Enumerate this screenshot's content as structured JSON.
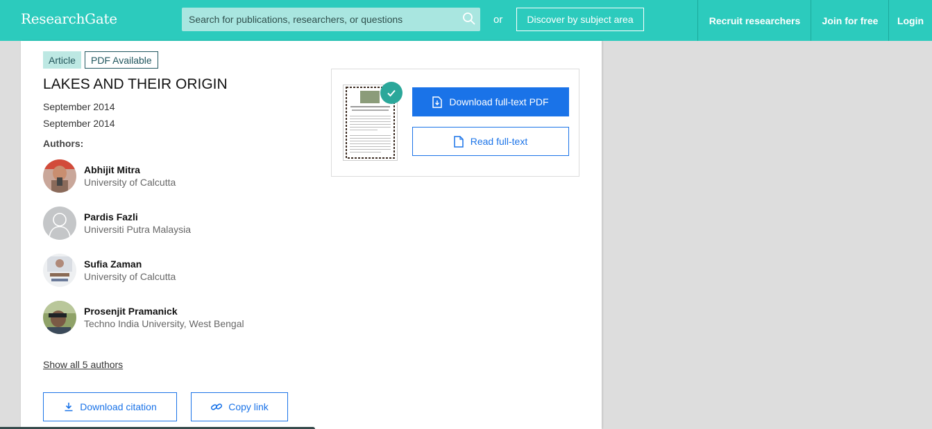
{
  "header": {
    "logo": "ResearchGate",
    "search_placeholder": "Search for publications, researchers, or questions",
    "or_text": "or",
    "discover_label": "Discover by subject area",
    "nav": [
      "Recruit researchers",
      "Join for free",
      "Login"
    ],
    "brand_color": "#2ccbbd"
  },
  "article": {
    "badge_type": "Article",
    "badge_pdf": "PDF Available",
    "title": "LAKES AND THEIR ORIGIN",
    "dates": [
      "September 2014",
      "September 2014"
    ],
    "authors_label": "Authors:",
    "authors": [
      {
        "name": "Abhijit Mitra",
        "affiliation": "University of Calcutta"
      },
      {
        "name": "Pardis Fazli",
        "affiliation": "Universiti Putra Malaysia"
      },
      {
        "name": "Sufia Zaman",
        "affiliation": "University of Calcutta"
      },
      {
        "name": "Prosenjit Pramanick",
        "affiliation": "Techno India University, West Bengal"
      }
    ],
    "show_all": "Show all 5 authors",
    "download_citation": "Download citation",
    "copy_link": "Copy link"
  },
  "pdf_panel": {
    "download_pdf": "Download full-text PDF",
    "read_fulltext": "Read full-text",
    "accent_color": "#1a73e8"
  }
}
